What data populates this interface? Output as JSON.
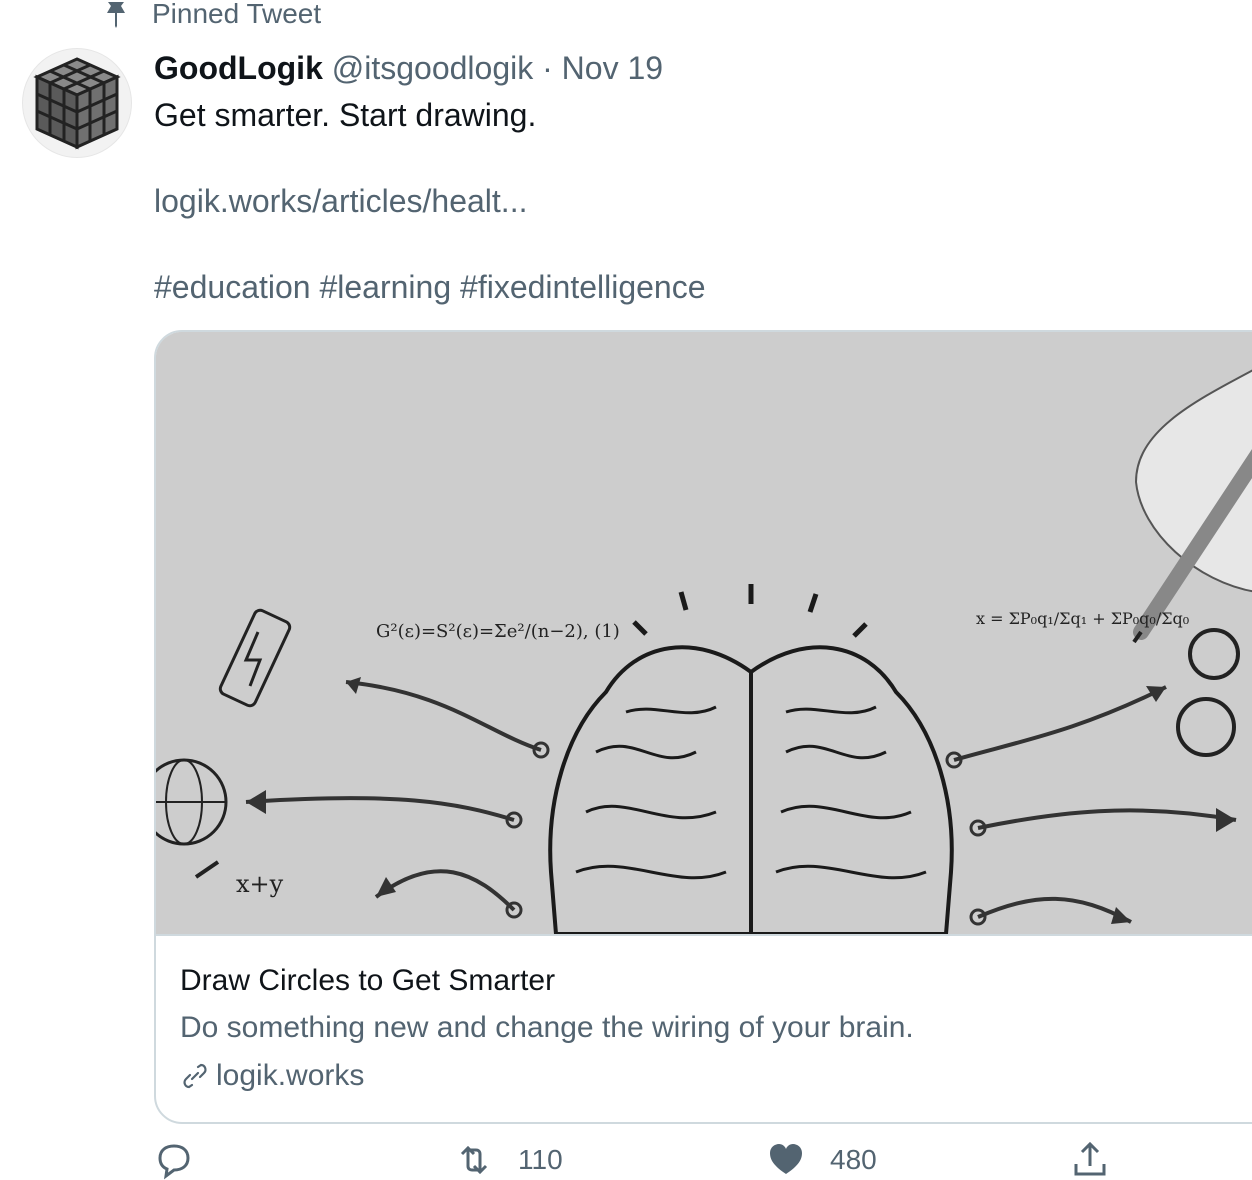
{
  "pinned": {
    "label": "Pinned Tweet",
    "icon": "pin-icon"
  },
  "tweet": {
    "author": {
      "display_name": "GoodLogik",
      "handle": "@itsgoodlogik",
      "avatar_icon": "rubiks-cube-avatar"
    },
    "separator": "·",
    "date": "Nov 19",
    "text": "Get smarter. Start drawing.",
    "link": "logik.works/articles/healt...",
    "hashtags": [
      "#education",
      "#learning",
      "#fixedintelligence"
    ],
    "card": {
      "image_icon": "brain-illustration",
      "title": "Draw Circles to Get Smarter",
      "description": "Do something new and change the wiring of your brain.",
      "domain": "logik.works",
      "domain_icon": "link-icon"
    },
    "actions": {
      "reply_count": "",
      "retweet_count": "110",
      "like_count": "480",
      "share_count": ""
    }
  },
  "colors": {
    "primary_text": "#0f1419",
    "secondary_text": "#536471",
    "border": "#cfd9de"
  }
}
